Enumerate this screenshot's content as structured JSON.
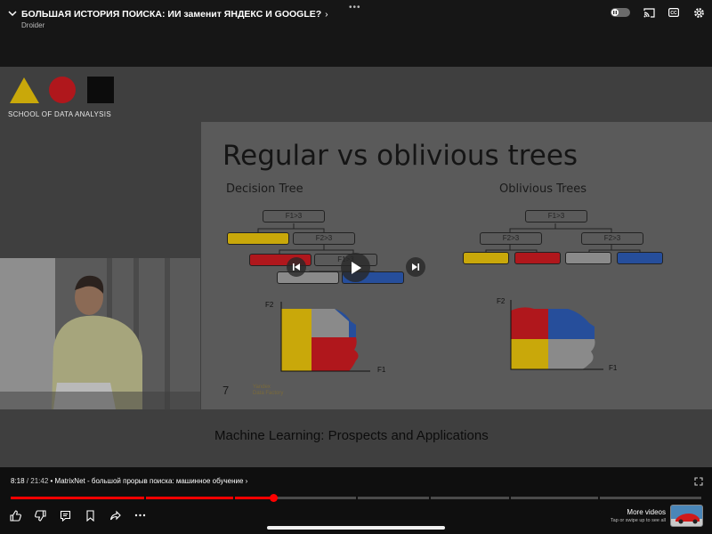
{
  "header": {
    "title": "БОЛЬШАЯ ИСТОРИЯ ПОИСКА: ИИ заменит ЯНДЕКС И GOOGLE?",
    "channel": "Droider"
  },
  "video": {
    "school_label": "SCHOOL OF DATA ANALYSIS",
    "slide": {
      "title": "Regular vs oblivious trees",
      "left_subtitle": "Decision Tree",
      "right_subtitle": "Oblivious Trees",
      "left_nodes": [
        "F1>3",
        "F2>3",
        "F1>3"
      ],
      "right_nodes": [
        "F1>3",
        "F2>3",
        "F2>3"
      ],
      "axis_f1": "F1",
      "axis_f2": "F2",
      "slide_number": "7",
      "sponsor": "Yandex\nData Factory"
    },
    "caption": "Machine Learning: Prospects and Applications"
  },
  "player": {
    "current_time": "8:18",
    "separator": " / ",
    "duration": "21:42",
    "chapter": " • MatrixNet - большой прорыв поиска: машинное обучение",
    "progress_fraction": 0.38,
    "more_videos_title": "More videos",
    "more_videos_hint": "Tap or swipe up to see all"
  },
  "colors": {
    "yellow": "#c9a80a",
    "red": "#b0171c",
    "gray": "#8a8a8a",
    "blue": "#264e9b",
    "progress_red": "#ff0000"
  },
  "icons": {
    "collapse": "chevron-down-icon",
    "autoplay": "autoplay-toggle-icon",
    "cast": "cast-icon",
    "captions": "captions-icon",
    "settings": "gear-icon",
    "like": "thumbs-up-icon",
    "dislike": "thumbs-down-icon",
    "comments": "comments-icon",
    "save": "bookmark-icon",
    "share": "share-icon",
    "more": "more-icon"
  }
}
